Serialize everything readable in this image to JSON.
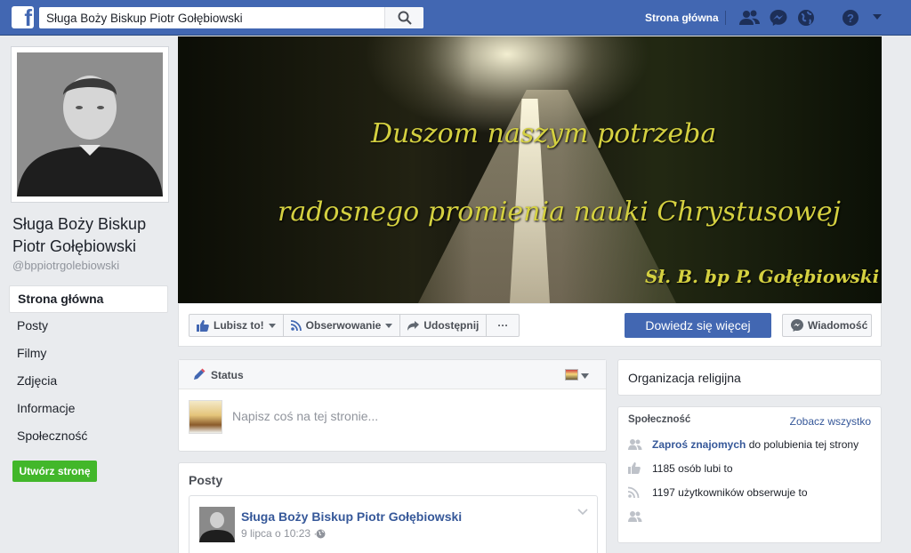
{
  "topbar": {
    "search_value": "Sługa Boży Biskup Piotr Gołębiowski",
    "home_link": "Strona główna",
    "brand_color": "#4267b2",
    "icons": [
      "friend-requests-icon",
      "messenger-icon",
      "notifications-globe-icon",
      "help-icon",
      "account-menu-caret-icon"
    ]
  },
  "page": {
    "name": "Sługa Boży Biskup Piotr Gołębiowski",
    "handle": "@bppiotrgolebiowski"
  },
  "nav": {
    "items": [
      {
        "label": "Strona główna"
      },
      {
        "label": "Posty"
      },
      {
        "label": "Filmy"
      },
      {
        "label": "Zdjęcia"
      },
      {
        "label": "Informacje"
      },
      {
        "label": "Społeczność"
      }
    ],
    "create_page": "Utwórz stronę"
  },
  "cover": {
    "line1": "Duszom naszym potrzeba",
    "line2": "radosnego promienia nauki Chrystusowej",
    "signature": "Sł. B. bp P. Gołębiowski"
  },
  "actions": {
    "like": "Lubisz to!",
    "follow": "Obserwowanie",
    "share": "Udostępnij",
    "more": "···",
    "learn_more": "Dowiedz się więcej",
    "message": "Wiadomość"
  },
  "composer": {
    "status_label": "Status",
    "placeholder": "Napisz coś na tej stronie..."
  },
  "posts": {
    "title": "Posty",
    "first": {
      "author": "Sługa Boży Biskup Piotr Gołębiowski",
      "time": "9 lipca o 10:23 ·"
    }
  },
  "sidebar_right": {
    "category": "Organizacja religijna",
    "community": {
      "title": "Społeczność",
      "see_all": "Zobacz wszystko",
      "invite_link": "Zaproś znajomych",
      "invite_rest": " do polubienia tej strony",
      "likes": "1185 osób lubi to",
      "follows": "1197 użytkowników obserwuje to"
    }
  }
}
